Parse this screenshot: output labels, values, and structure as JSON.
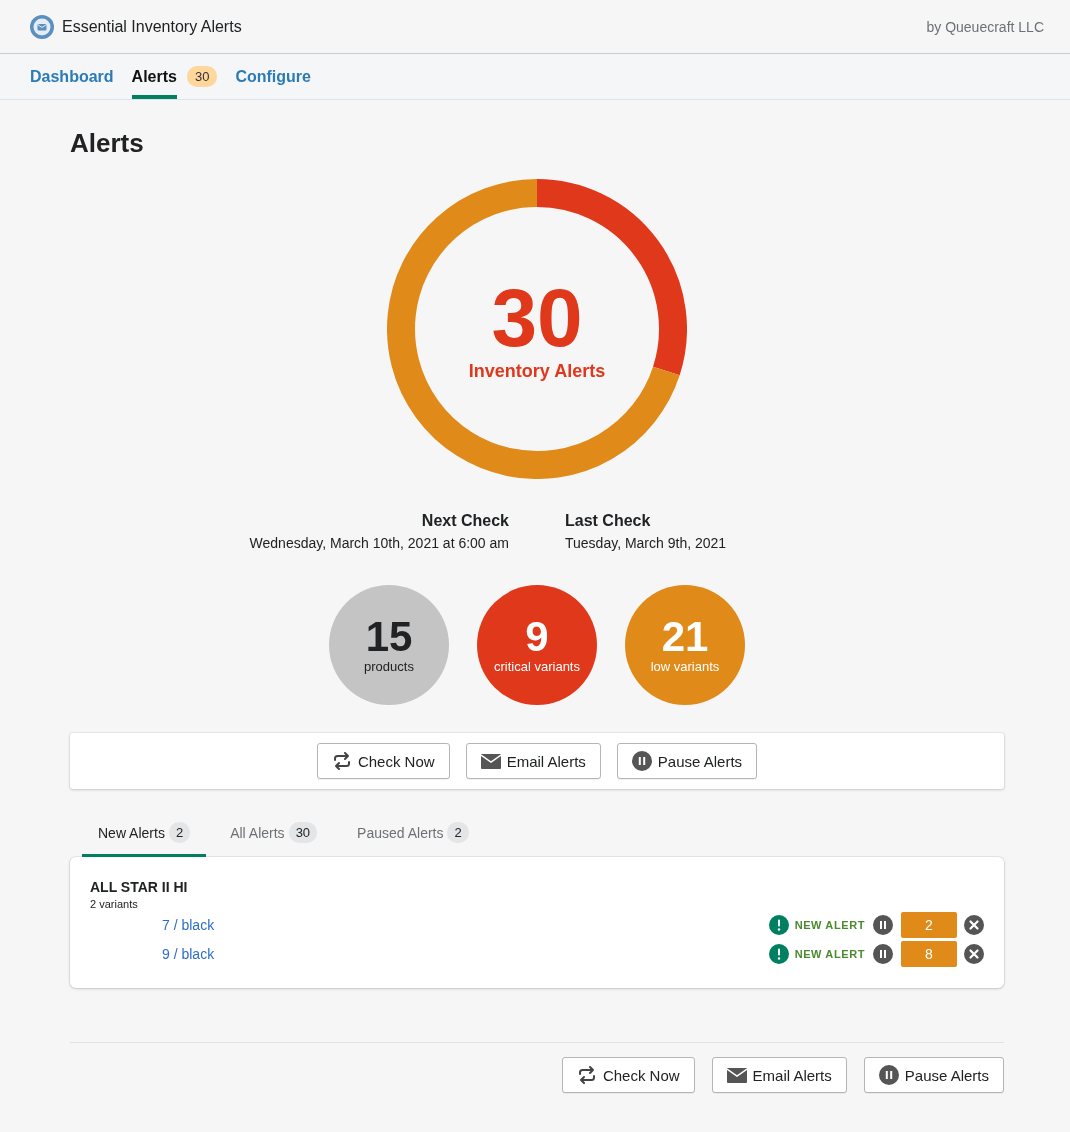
{
  "app": {
    "title": "Essential Inventory Alerts",
    "vendor": "by Queuecraft LLC"
  },
  "nav": [
    {
      "label": "Dashboard",
      "selected": false
    },
    {
      "label": "Alerts",
      "selected": true,
      "badge": "30"
    },
    {
      "label": "Configure",
      "selected": false
    }
  ],
  "page_title": "Alerts",
  "summary": {
    "total": "30",
    "caption": "Inventory Alerts"
  },
  "checks": [
    {
      "label": "Next Check",
      "value": "Wednesday, March 10th, 2021 at 6:00 am"
    },
    {
      "label": "Last Check",
      "value": "Tuesday, March 9th, 2021"
    }
  ],
  "stats": [
    {
      "value": "15",
      "label": "products",
      "color": "#c4c4c4"
    },
    {
      "value": "9",
      "label": "critical variants",
      "color": "#e0381b"
    },
    {
      "value": "21",
      "label": "low variants",
      "color": "#e08a1a"
    }
  ],
  "actions": [
    {
      "kind": "check",
      "label": "Check Now"
    },
    {
      "kind": "email",
      "label": "Email Alerts"
    },
    {
      "kind": "pause",
      "label": "Pause Alerts"
    }
  ],
  "alert_tabs": [
    {
      "label": "New Alerts",
      "count": "2",
      "selected": true
    },
    {
      "label": "All Alerts",
      "count": "30",
      "selected": false
    },
    {
      "label": "Paused Alerts",
      "count": "2",
      "selected": false
    }
  ],
  "products": [
    {
      "name": "ALL STAR II HI",
      "subtitle": "2 variants",
      "variants": [
        {
          "name": "7 / black",
          "status": "NEW ALERT",
          "quantity": "2"
        },
        {
          "name": "9 / black",
          "status": "NEW ALERT",
          "quantity": "8"
        }
      ]
    }
  ],
  "footer_actions": [
    {
      "kind": "check",
      "label": "Check Now"
    },
    {
      "kind": "email",
      "label": "Email Alerts"
    },
    {
      "kind": "pause",
      "label": "Pause Alerts"
    }
  ]
}
